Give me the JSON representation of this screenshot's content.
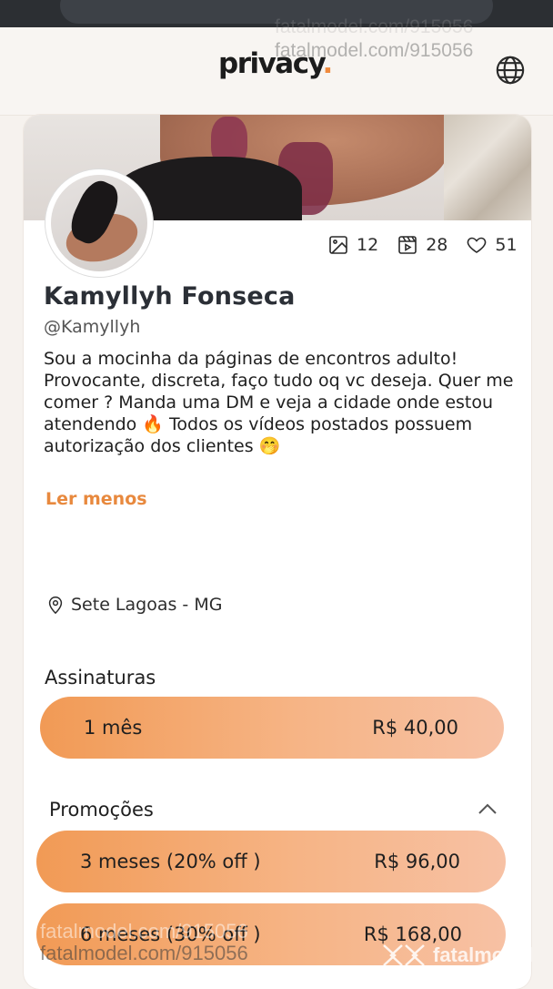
{
  "watermark": {
    "url": "fatalmodel.com/915056",
    "brand": "fatalmodel"
  },
  "header": {
    "logo": "privacy",
    "logo_dot": "."
  },
  "profile": {
    "stats": {
      "photos": "12",
      "videos": "28",
      "likes": "51"
    },
    "name": "Kamyllyh Fonseca",
    "handle": "@Kamyllyh",
    "bio": "Sou a mocinha da páginas de encontros adulto! Provocante, discreta, faço tudo oq vc deseja. Quer me comer ? Manda uma DM e veja a cidade onde estou atendendo 🔥 Todos os vídeos postados possuem autorização dos clientes 🤭",
    "read_less": "Ler menos",
    "location": "Sete Lagoas - MG"
  },
  "subscriptions": {
    "title": "Assinaturas",
    "plans": [
      {
        "label": "1 mês",
        "price": "R$ 40,00"
      }
    ]
  },
  "promotions": {
    "title": "Promoções",
    "plans": [
      {
        "label": "3 meses (20% off )",
        "price": "R$ 96,00"
      },
      {
        "label": "6 meses (30% off )",
        "price": "R$ 168,00"
      }
    ]
  },
  "colors": {
    "accent": "#e8893e",
    "button_start": "#f19a55",
    "button_end": "#f7c1a4"
  }
}
